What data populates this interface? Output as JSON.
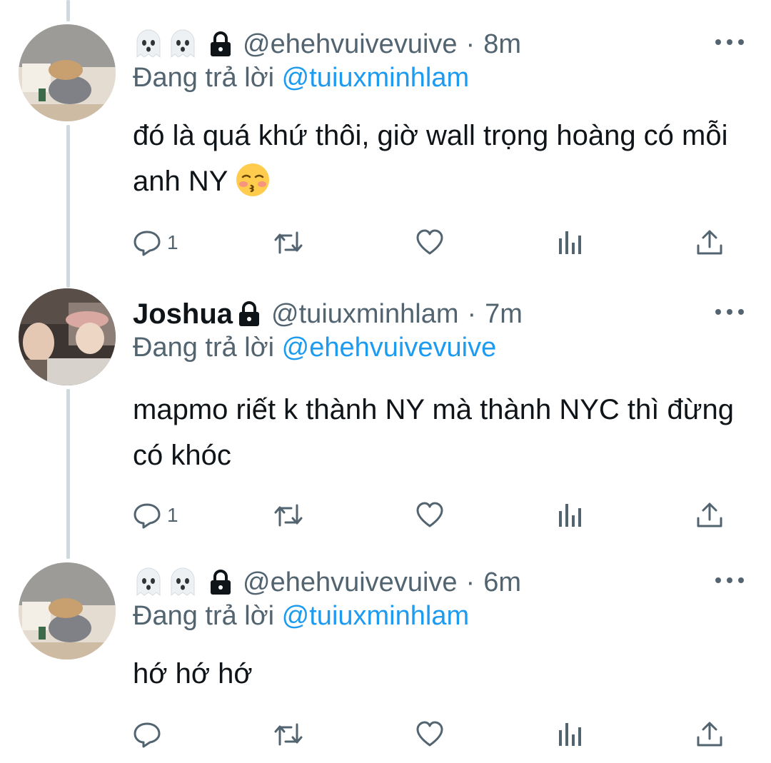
{
  "tweets": [
    {
      "display_name": "",
      "handle": "@ehehvuivevuive",
      "time": "8m",
      "reply_label": "Đang trả lời",
      "reply_mention": "@tuiuxminhlam",
      "text": "đó là quá khứ thôi, giờ wall trọng hoàng có mỗi anh NY",
      "emoji": "kissing-face-blushing",
      "reply_count": "1",
      "icons": [
        "ghost-icon",
        "ghost-icon",
        "lock-icon"
      ]
    },
    {
      "display_name": "Joshua",
      "handle": "@tuiuxminhlam",
      "time": "7m",
      "reply_label": "Đang trả lời",
      "reply_mention": "@ehehvuivevuive",
      "text": "mapmo riết k thành NY mà thành NYC thì đừng có khóc",
      "reply_count": "1",
      "icons": [
        "lock-icon"
      ]
    },
    {
      "display_name": "",
      "handle": "@ehehvuivevuive",
      "time": "6m",
      "reply_label": "Đang trả lời",
      "reply_mention": "@tuiuxminhlam",
      "text": "hớ hớ hớ",
      "reply_count": "",
      "icons": [
        "ghost-icon",
        "ghost-icon",
        "lock-icon"
      ]
    }
  ],
  "separator": "·",
  "colors": {
    "text": "#0f1419",
    "secondary": "#536471",
    "mention": "#1d9bf0",
    "thread_line": "#cfd9de"
  }
}
